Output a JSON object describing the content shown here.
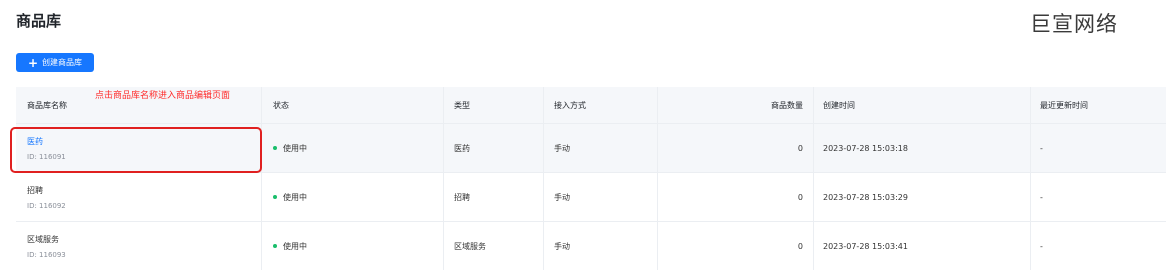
{
  "page": {
    "title": "商品库",
    "brand": "巨宣网络"
  },
  "toolbar": {
    "create_label": "创建商品库",
    "create_icon": "plus-icon"
  },
  "annotation": {
    "hint": "点击商品库名称进入商品编辑页面",
    "color": "#ff2a2a"
  },
  "table": {
    "headers": {
      "name": "商品库名称",
      "status": "状态",
      "type": "类型",
      "access": "接入方式",
      "count": "商品数量",
      "created": "创建时间",
      "updated": "最近更新时间"
    },
    "rows": [
      {
        "name": "医药",
        "id": "ID: 116091",
        "status": "使用中",
        "type": "医药",
        "access": "手动",
        "count": "0",
        "created": "2023-07-28 15:03:18",
        "updated": "-"
      },
      {
        "name": "招聘",
        "id": "ID: 116092",
        "status": "使用中",
        "type": "招聘",
        "access": "手动",
        "count": "0",
        "created": "2023-07-28 15:03:29",
        "updated": "-"
      },
      {
        "name": "区域服务",
        "id": "ID: 116093",
        "status": "使用中",
        "type": "区域服务",
        "access": "手动",
        "count": "0",
        "created": "2023-07-28 15:03:41",
        "updated": "-"
      }
    ]
  },
  "colors": {
    "primary": "#1677ff",
    "status_active": "#19be6b",
    "highlight": "#e02020"
  }
}
